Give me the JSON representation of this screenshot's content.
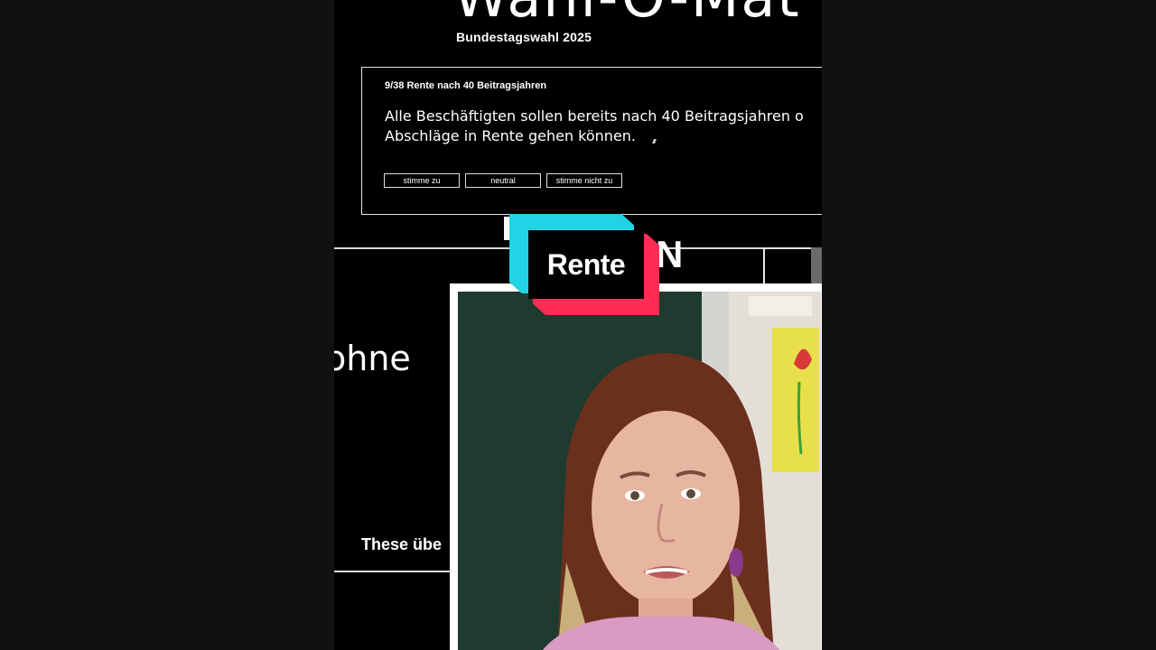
{
  "header": {
    "title": "Wahl-O-Mat",
    "subtitle": "Bundestagswahl 2025"
  },
  "thesis": {
    "label": "9/38 Rente nach 40 Beitragsjahren",
    "text": "Alle Beschäftigten sollen bereits nach 40 Beitragsjahren o\nAbschläge in Rente gehen können.",
    "buttons": {
      "agree": "stimme zu",
      "neutral": "neutral",
      "disagree": "stimme nicht zu"
    }
  },
  "background_card": {
    "partial_word": "ohne",
    "fragment": "N",
    "these_label": "These übe"
  },
  "overlay": {
    "badge_text": "Rente",
    "colors": {
      "cyan": "#22d3e6",
      "red": "#ff2d55"
    }
  }
}
